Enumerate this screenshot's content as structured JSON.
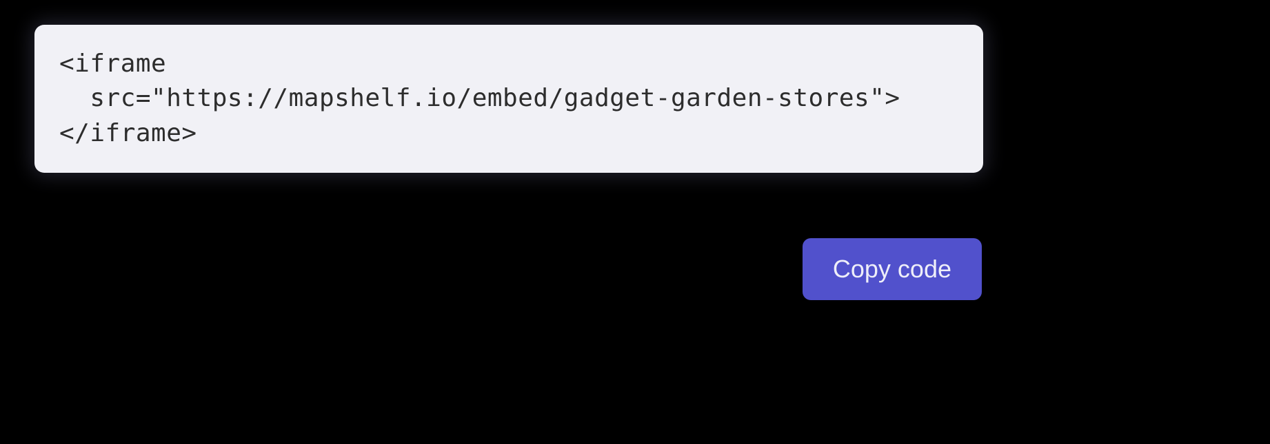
{
  "code_block": {
    "content": "<iframe\n  src=\"https://mapshelf.io/embed/gadget-garden-stores\">\n</iframe>"
  },
  "actions": {
    "copy_label": "Copy code"
  }
}
